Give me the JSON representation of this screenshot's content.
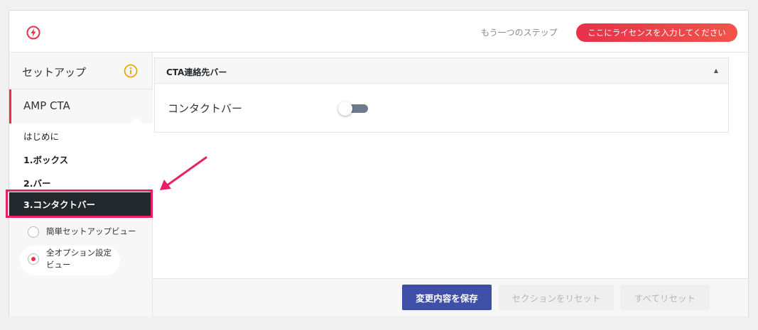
{
  "header": {
    "step_text": "もう一つのステップ",
    "license_button": "ここにライセンスを入力してください"
  },
  "sidebar": {
    "setup_label": "セットアップ",
    "section_label": "AMP CTA",
    "items": [
      {
        "label": "はじめに"
      },
      {
        "label": "1.ボックス"
      },
      {
        "label": "2.バー"
      },
      {
        "label": "3.コンタクトバー",
        "active": true
      }
    ],
    "view_options": [
      {
        "label": "簡単セットアップビュー",
        "selected": false
      },
      {
        "label_line1": "全オプション設定",
        "label_line2": "ビュー",
        "selected": true
      }
    ]
  },
  "main": {
    "section_title": "CTA連絡先バー",
    "field_label": "コンタクトバー",
    "toggle_on": false
  },
  "footer": {
    "save_button": "変更内容を保存",
    "reset_section_button": "セクションをリセット",
    "reset_all_button": "すべてリセット"
  },
  "colors": {
    "accent_red": "#e8304a",
    "primary_blue": "#3f4fa8",
    "highlight_pink": "#ec1e66",
    "info_orange": "#f0a500"
  },
  "icons": {
    "logo": "bolt-circle-icon",
    "info": "info-icon",
    "caret": "caret-up-icon",
    "annotation": "arrow-icon"
  }
}
